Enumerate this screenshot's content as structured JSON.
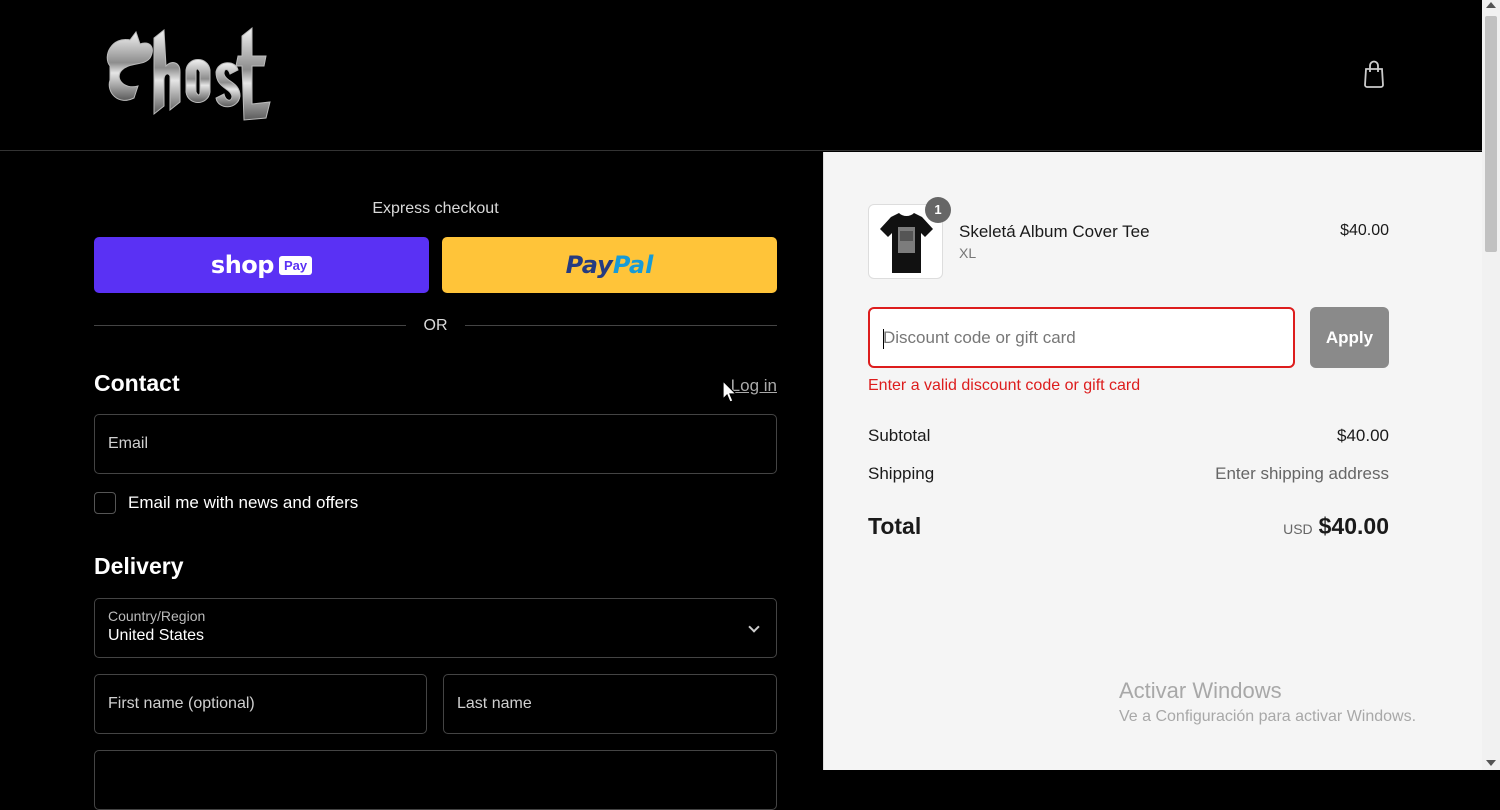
{
  "header": {
    "logo_alt": "Ghost",
    "cart_icon": "shopping-bag-icon"
  },
  "express": {
    "title": "Express checkout",
    "shop_pay": {
      "shop": "shop",
      "pay": "Pay"
    },
    "paypal": {
      "part1": "Pay",
      "part2": "Pal"
    },
    "or": "OR"
  },
  "contact": {
    "title": "Contact",
    "login": "Log in",
    "email_placeholder": "Email",
    "newsletter_label": "Email me with news and offers"
  },
  "delivery": {
    "title": "Delivery",
    "country_label": "Country/Region",
    "country_value": "United States",
    "first_name_placeholder": "First name (optional)",
    "last_name_placeholder": "Last name"
  },
  "order": {
    "item": {
      "name": "Skeletá Album Cover Tee",
      "variant": "XL",
      "price": "$40.00",
      "quantity": "1"
    },
    "discount": {
      "placeholder": "Discount code or gift card",
      "apply": "Apply",
      "error": "Enter a valid discount code or gift card"
    },
    "subtotal_label": "Subtotal",
    "subtotal_value": "$40.00",
    "shipping_label": "Shipping",
    "shipping_value": "Enter shipping address",
    "total_label": "Total",
    "currency": "USD",
    "total_value": "$40.00"
  },
  "watermark": {
    "title": "Activar Windows",
    "subtitle": "Ve a Configuración para activar Windows."
  },
  "colors": {
    "shop_pay": "#5a31f4",
    "paypal": "#ffc439",
    "error": "#dd1d1d",
    "background": "#000000",
    "summary_bg": "#f5f5f5"
  }
}
